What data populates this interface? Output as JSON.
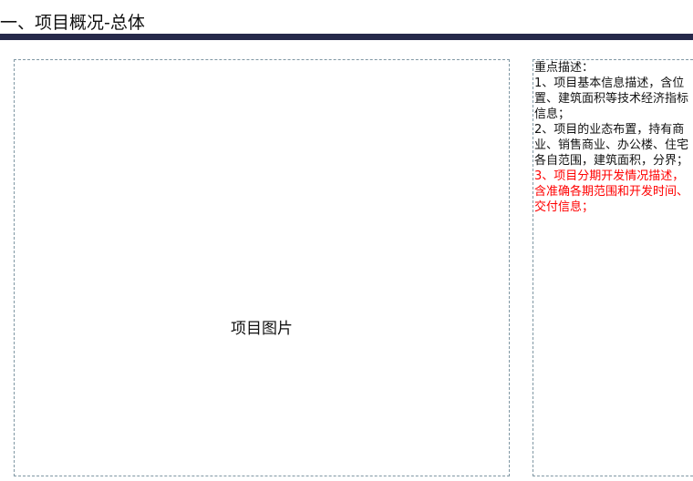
{
  "header": {
    "title": "一、项目概况-总体"
  },
  "image_placeholder": {
    "label": "项目图片"
  },
  "description": {
    "heading": "重点描述：",
    "item1": "1、项目基本信息描述，含位置、建筑面积等技术经济指标信息；",
    "item2": "2、项目的业态布置，持有商业、销售商业、办公楼、住宅各自范围，建筑面积，分界；",
    "item3": "3、项目分期开发情况描述，含准确各期范围和开发时间、交付信息；"
  },
  "colors": {
    "title_bar": "#26294a",
    "highlight": "#ff0000",
    "dashed_border": "#7f97a3"
  }
}
